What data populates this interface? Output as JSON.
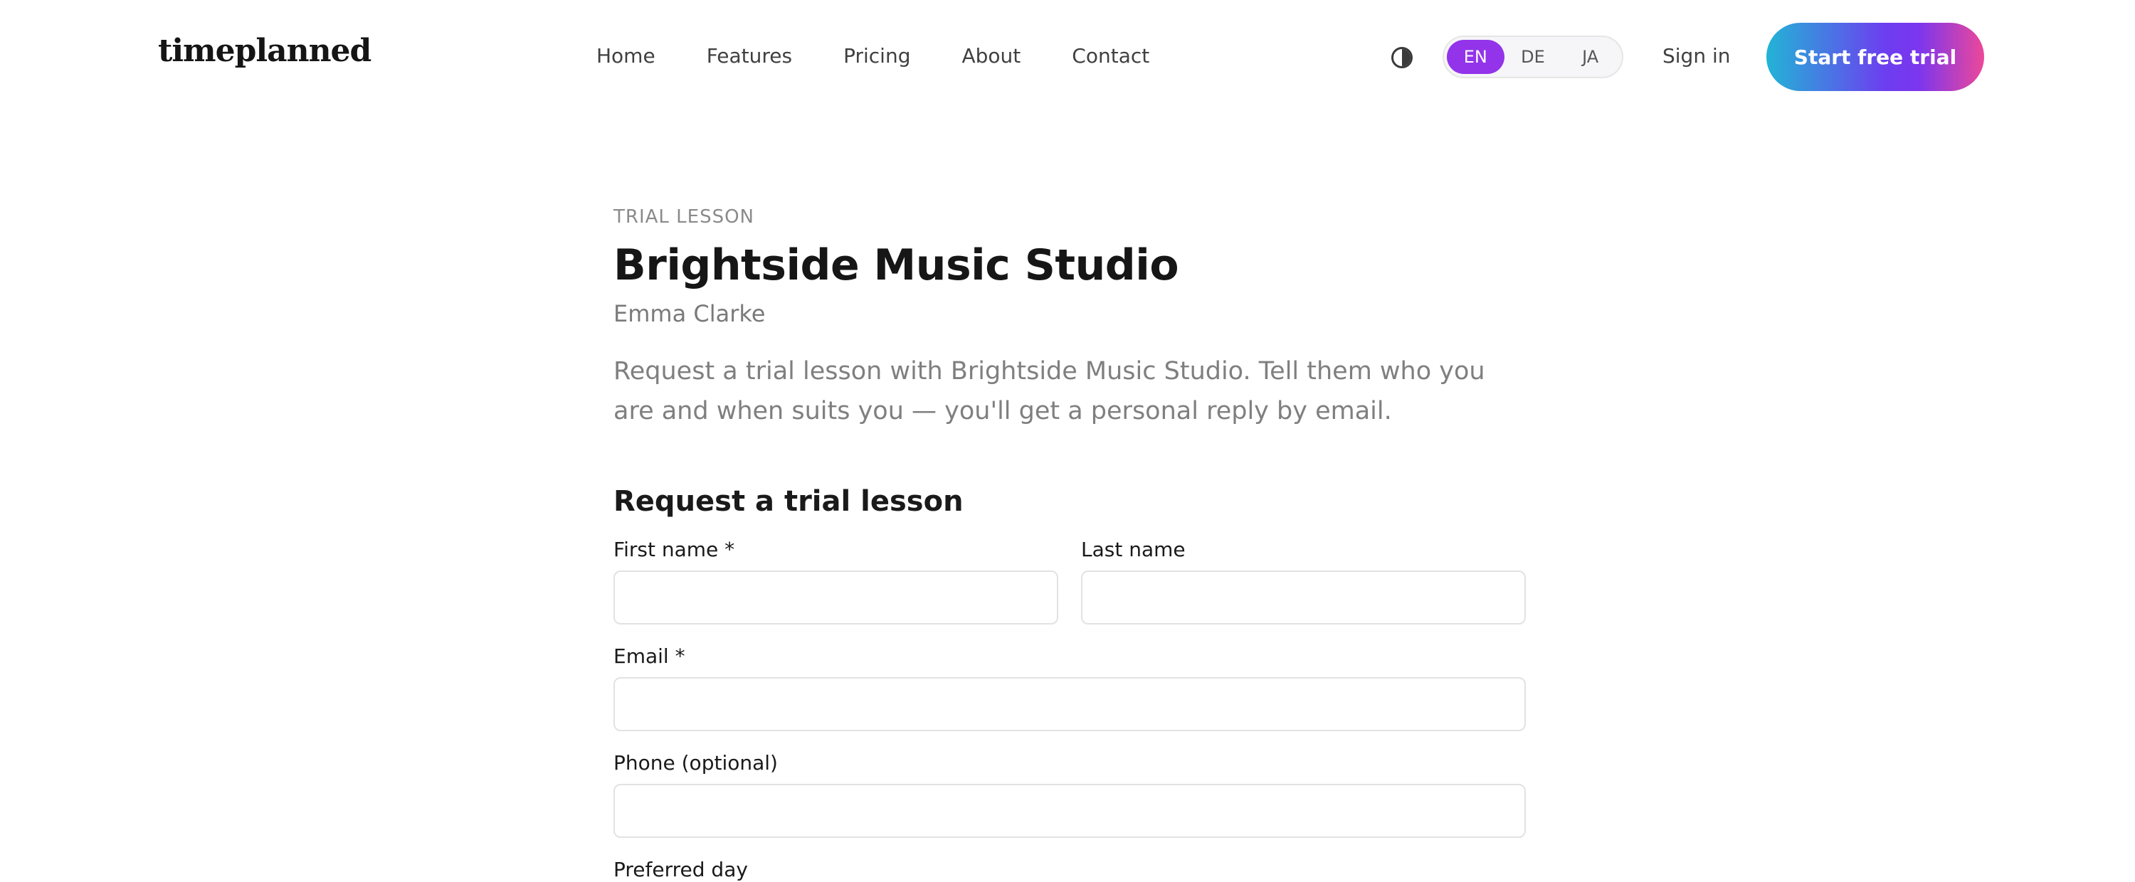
{
  "header": {
    "logo": "timeplanned",
    "nav": [
      "Home",
      "Features",
      "Pricing",
      "About",
      "Contact"
    ],
    "languages": [
      "EN",
      "DE",
      "JA"
    ],
    "active_language": "EN",
    "sign_in": "Sign in",
    "cta": "Start free trial"
  },
  "main": {
    "eyebrow": "TRIAL LESSON",
    "title": "Brightside Music Studio",
    "subtitle": "Emma Clarke",
    "description": "Request a trial lesson with Brightside Music Studio. Tell them who you are and when suits you — you'll get a personal reply by email.",
    "form_title": "Request a trial lesson",
    "fields": {
      "first_name": {
        "label": "First name *",
        "value": ""
      },
      "last_name": {
        "label": "Last name",
        "value": ""
      },
      "email": {
        "label": "Email *",
        "value": ""
      },
      "phone": {
        "label": "Phone (optional)",
        "value": ""
      },
      "next_label": "Preferred day"
    }
  },
  "colors": {
    "accent": "#9333ea",
    "cta_start": "#22b4d6",
    "cta_mid": "#7b36ee",
    "cta_end": "#ec4899"
  },
  "icons": {
    "theme_toggle": "contrast-icon"
  }
}
